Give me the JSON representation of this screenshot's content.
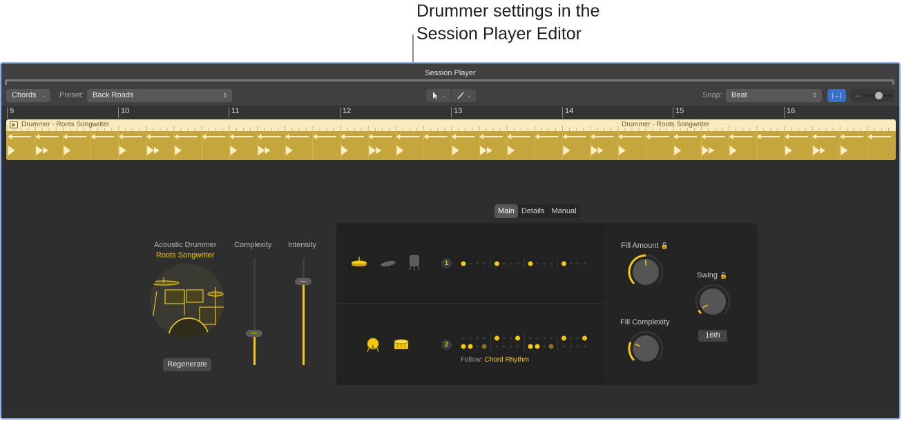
{
  "callout": {
    "line1": "Drummer settings in the",
    "line2": "Session Player Editor"
  },
  "window": {
    "title": "Session Player"
  },
  "toolbar": {
    "mode_label": "Chords",
    "preset_label": "Preset:",
    "preset_value": "Back Roads",
    "pointer_tool_icon": "pointer-icon",
    "pencil_tool_icon": "pencil-icon",
    "snap_label": "Snap:",
    "snap_value": "Beat",
    "fit_icon": "fit-width-icon",
    "zoom_icon": "horizontal-zoom-icon",
    "zoom_level": 0.6
  },
  "ruler": {
    "bars": [
      "9",
      "10",
      "11",
      "12",
      "13",
      "14",
      "15",
      "16"
    ]
  },
  "region": {
    "name": "Drummer - Roots Songwriter",
    "name_repeat": "Drummer - Roots Songwriter"
  },
  "drummer": {
    "type_label": "Acoustic Drummer",
    "name": "Roots Songwriter",
    "regenerate_label": "Regenerate",
    "complexity_label": "Complexity",
    "complexity_value": 0.3,
    "intensity_label": "Intensity",
    "intensity_value": 0.78
  },
  "tabs": [
    {
      "label": "Main",
      "active": true
    },
    {
      "label": "Details",
      "active": false
    },
    {
      "label": "Manual",
      "active": false
    }
  ],
  "pattern": {
    "row1": {
      "badge": "1",
      "instruments": [
        {
          "icon": "hihat-icon",
          "active": true
        },
        {
          "icon": "cymbal-icon",
          "active": false
        },
        {
          "icon": "floor-tom-icon",
          "active": false
        }
      ]
    },
    "row2": {
      "badge": "2",
      "instruments": [
        {
          "icon": "kick-drum-icon",
          "active": true
        },
        {
          "icon": "snare-drum-icon",
          "active": true
        }
      ],
      "follow_label": "Follow:",
      "follow_value": "Chord Rhythm"
    }
  },
  "knobs": {
    "fill_amount_label": "Fill Amount",
    "fill_amount_value": 0.5,
    "fill_complexity_label": "Fill Complexity",
    "fill_complexity_value": 0.25,
    "swing_label": "Swing",
    "swing_value": 0.05,
    "swing_resolution": "16th",
    "lock_icon": "unlock-icon"
  },
  "colors": {
    "accent": "#f5c90e",
    "region_body": "#c5a63c",
    "region_header": "#f9ecbf",
    "selection_blue": "#3a70c8",
    "window_border": "#8fb3ec"
  }
}
